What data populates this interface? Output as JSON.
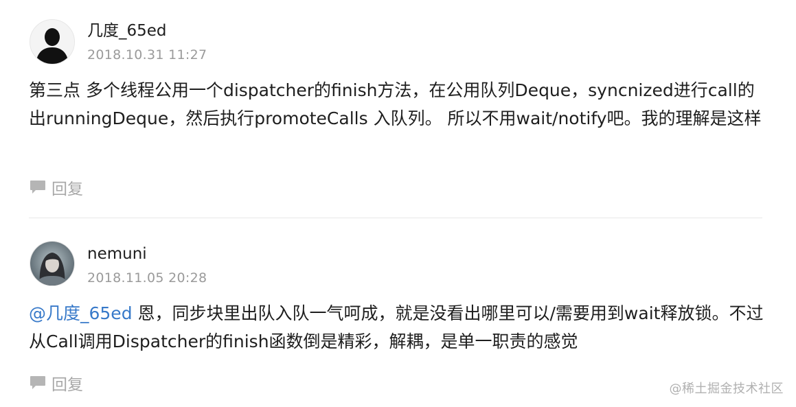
{
  "comments": [
    {
      "username": "几度_65ed",
      "timestamp": "2018.10.31 11:27",
      "mention": "",
      "text": "第三点 多个线程公用一个dispatcher的finish方法，在公用队列Deque，syncnized进行call的出runningDeque，然后执行promoteCalls 入队列。 所以不用wait/notify吧。我的理解是这样",
      "reply_label": "回复",
      "avatar_icon": "default-user-silhouette"
    },
    {
      "username": "nemuni",
      "timestamp": "2018.11.05 20:28",
      "mention": "@几度_65ed",
      "text": " 恩，同步块里出队入队一气呵成，就是没看出哪里可以/需要用到wait释放锁。不过从Call调用Dispatcher的finish函数倒是精彩，解耦，是单一职责的感觉",
      "reply_label": "回复",
      "avatar_icon": "user-photo-avatar"
    }
  ],
  "watermark": "@稀土掘金技术社区",
  "colors": {
    "mention": "#3779c9",
    "username": "#1e1e1e",
    "timestamp": "#9a9a9a",
    "reply": "#a8a8a8"
  }
}
